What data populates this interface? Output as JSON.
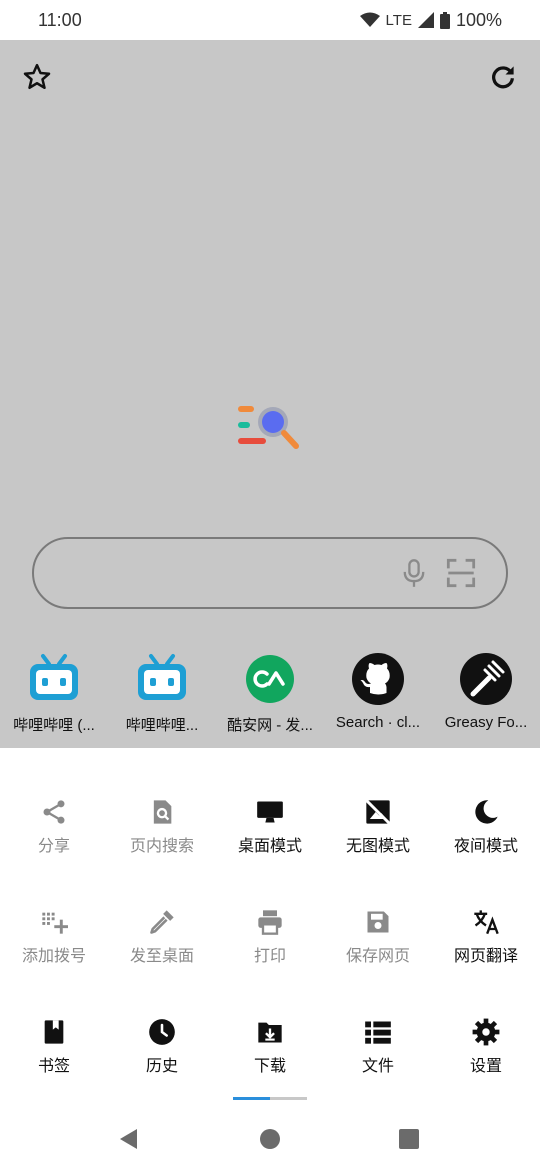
{
  "status": {
    "time": "11:00",
    "network": "LTE",
    "battery": "100%"
  },
  "browser": {
    "search": {
      "placeholder": ""
    },
    "shortcuts": [
      {
        "label": "哔哩哔哩 (...",
        "icon": "bilibili-icon"
      },
      {
        "label": "哔哩哔哩...",
        "icon": "bilibili-icon"
      },
      {
        "label": "酷安网 - 发...",
        "icon": "coolapk-icon"
      },
      {
        "label": "Search · cl...",
        "icon": "github-icon"
      },
      {
        "label": "Greasy Fo...",
        "icon": "greasyfork-icon"
      }
    ]
  },
  "menu": {
    "row1": [
      {
        "label": "分享",
        "icon": "share-icon",
        "enabled": false
      },
      {
        "label": "页内搜索",
        "icon": "find-in-page-icon",
        "enabled": false
      },
      {
        "label": "桌面模式",
        "icon": "desktop-icon",
        "enabled": true
      },
      {
        "label": "无图模式",
        "icon": "no-image-icon",
        "enabled": true
      },
      {
        "label": "夜间模式",
        "icon": "moon-icon",
        "enabled": true
      }
    ],
    "row2": [
      {
        "label": "添加拨号",
        "icon": "add-dial-icon",
        "enabled": false
      },
      {
        "label": "发至桌面",
        "icon": "pipette-icon",
        "enabled": false
      },
      {
        "label": "打印",
        "icon": "print-icon",
        "enabled": false
      },
      {
        "label": "保存网页",
        "icon": "save-icon",
        "enabled": false
      },
      {
        "label": "网页翻译",
        "icon": "translate-icon",
        "enabled": true
      }
    ],
    "row3": [
      {
        "label": "书签",
        "icon": "bookmark-icon",
        "enabled": true
      },
      {
        "label": "历史",
        "icon": "clock-icon",
        "enabled": true
      },
      {
        "label": "下载",
        "icon": "download-icon",
        "enabled": true
      },
      {
        "label": "文件",
        "icon": "list-icon",
        "enabled": true
      },
      {
        "label": "设置",
        "icon": "gear-icon",
        "enabled": true
      }
    ],
    "page_indicator": {
      "current": 1,
      "total": 2
    }
  },
  "colors": {
    "browser_bg": "#c7c7c7",
    "accent": "#2a8fdc",
    "disabled": "#8a8a8a",
    "bilibili": "#1e9fd4",
    "coolapk": "#11a65e"
  }
}
